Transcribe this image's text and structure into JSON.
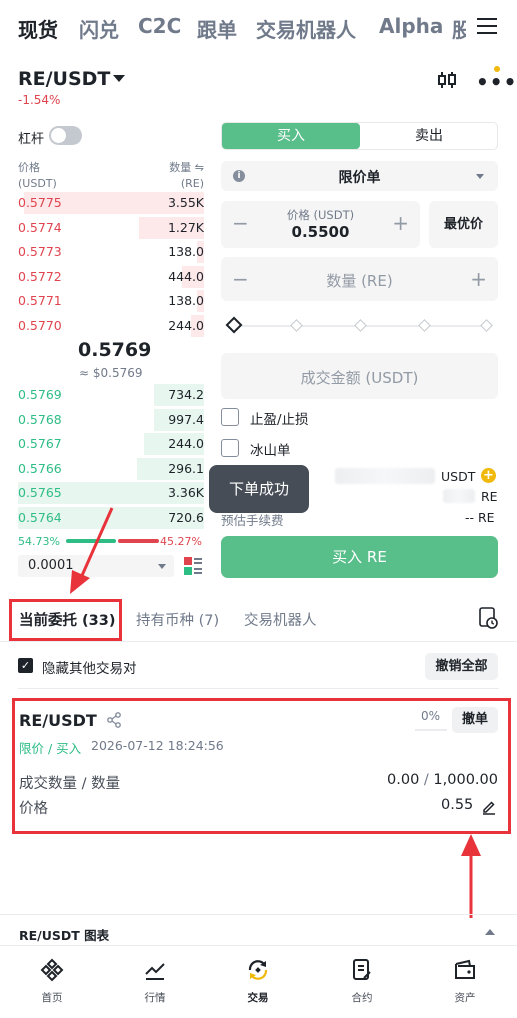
{
  "top_tabs": [
    "现货",
    "闪兑",
    "C2C",
    "跟单",
    "交易机器人",
    "Alpha",
    "股"
  ],
  "pair": {
    "symbol": "RE/USDT",
    "change": "-1.54%"
  },
  "leverage_label": "杠杆",
  "orderbook": {
    "price_header": "价格",
    "price_unit": "(USDT)",
    "qty_header": "数量 ⇋",
    "qty_unit": "(RE)",
    "asks": [
      {
        "price": "0.5775",
        "qty": "3.55K",
        "depth": 0.97
      },
      {
        "price": "0.5774",
        "qty": "1.27K",
        "depth": 0.35
      },
      {
        "price": "0.5773",
        "qty": "138.0",
        "depth": 0.04
      },
      {
        "price": "0.5772",
        "qty": "444.0",
        "depth": 0.12
      },
      {
        "price": "0.5771",
        "qty": "138.0",
        "depth": 0.04
      },
      {
        "price": "0.5770",
        "qty": "244.0",
        "depth": 0.07
      }
    ],
    "mid_price": "0.5769",
    "mid_fiat": "≈ $0.5769",
    "bids": [
      {
        "price": "0.5769",
        "qty": "734.2",
        "depth": 0.27
      },
      {
        "price": "0.5768",
        "qty": "997.4",
        "depth": 0.27
      },
      {
        "price": "0.5767",
        "qty": "244.0",
        "depth": 0.32
      },
      {
        "price": "0.5766",
        "qty": "296.1",
        "depth": 0.36
      },
      {
        "price": "0.5765",
        "qty": "3.36K",
        "depth": 1.0
      },
      {
        "price": "0.5764",
        "qty": "720.6",
        "depth": 1.0
      }
    ],
    "buy_ratio": "54.73%",
    "sell_ratio": "45.27%",
    "precision": "0.0001"
  },
  "form": {
    "buy_tab": "买入",
    "sell_tab": "卖出",
    "order_type": "限价单",
    "price_label": "价格 (USDT)",
    "price_value": "0.5500",
    "best_price": "最优价",
    "qty_placeholder": "数量 (RE)",
    "amount_placeholder": "成交金额 (USDT)",
    "tp_sl": "止盈/止损",
    "iceberg": "冰山单",
    "usdt_unit": "USDT",
    "re_unit": "RE",
    "fee_label": "预估手续费",
    "fee_value": "-- RE",
    "buy_button": "买入 RE",
    "toast": "下单成功"
  },
  "order_tabs": [
    "当前委托 (33)",
    "持有币种 (7)",
    "交易机器人"
  ],
  "hide_others": "隐藏其他交易对",
  "cancel_all": "撤销全部",
  "order": {
    "pair": "RE/USDT",
    "progress": "0%",
    "cancel": "撤单",
    "type": "限价 / 买入",
    "time": "2026-07-12 18:24:56",
    "filled_label": "成交数量 / 数量",
    "filled": "0.00",
    "total": "1,000.00",
    "price_label": "价格",
    "price": "0.55"
  },
  "chart_label": "RE/USDT 图表",
  "bottom_nav": [
    "首页",
    "行情",
    "交易",
    "合约",
    "资产"
  ],
  "colors": {
    "buy": "#2ebd85",
    "sell": "#e0454f",
    "accent": "#f0b90b",
    "highlight": "#e8333b"
  }
}
